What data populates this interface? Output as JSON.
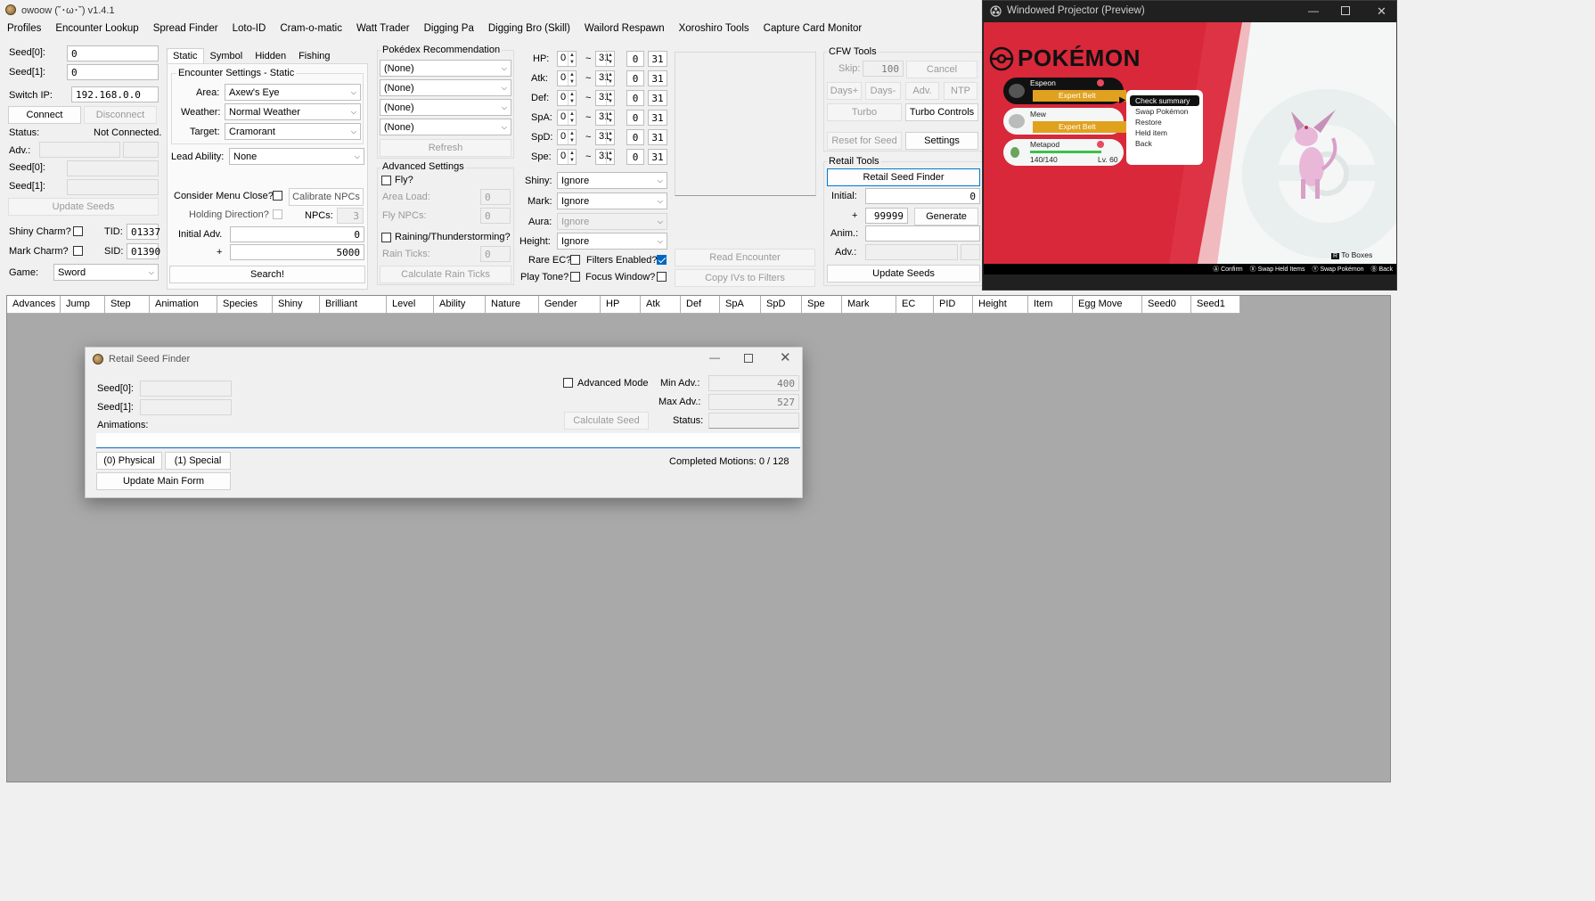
{
  "window": {
    "title": "owoow (˘･ω･˘) v1.4.1"
  },
  "menu": [
    "Profiles",
    "Encounter Lookup",
    "Spread Finder",
    "Loto-ID",
    "Cram-o-matic",
    "Watt Trader",
    "Digging Pa",
    "Digging Bro (Skill)",
    "Wailord Respawn",
    "Xoroshiro Tools",
    "Capture Card Monitor"
  ],
  "left": {
    "seed0_label": "Seed[0]:",
    "seed0": "0",
    "seed1_label": "Seed[1]:",
    "seed1": "0",
    "switch_ip_label": "Switch IP:",
    "switch_ip": "192.168.0.0",
    "connect": "Connect",
    "disconnect": "Disconnect",
    "status_label": "Status:",
    "status": "Not Connected.",
    "adv_label": "Adv.:",
    "seed0b_label": "Seed[0]:",
    "seed1b_label": "Seed[1]:",
    "update_seeds": "Update Seeds",
    "shiny_charm": "Shiny Charm?",
    "mark_charm": "Mark Charm?",
    "tid_label": "TID:",
    "tid": "01337",
    "sid_label": "SID:",
    "sid": "01390",
    "game_label": "Game:",
    "game": "Sword"
  },
  "encounter": {
    "tabs": [
      "Static",
      "Symbol",
      "Hidden",
      "Fishing"
    ],
    "group_title": "Encounter Settings - Static",
    "area_label": "Area:",
    "area": "Axew's Eye",
    "weather_label": "Weather:",
    "weather": "Normal Weather",
    "target_label": "Target:",
    "target": "Cramorant",
    "lead_label": "Lead Ability:",
    "lead": "None",
    "menu_close": "Consider Menu Close?",
    "calibrate": "Calibrate NPCs",
    "holding": "Holding Direction?",
    "npcs_label": "NPCs:",
    "npcs": "3",
    "initial_label": "Initial Adv.",
    "initial": "0",
    "plus": "+",
    "plus_val": "5000",
    "search": "Search!"
  },
  "pokedex": {
    "title": "Pokédex Recommendation",
    "options": [
      "(None)",
      "(None)",
      "(None)",
      "(None)"
    ],
    "refresh": "Refresh",
    "adv_title": "Advanced Settings",
    "fly": "Fly?",
    "area_load": "Area Load:",
    "area_load_val": "0",
    "fly_npcs": "Fly NPCs:",
    "fly_npcs_val": "0",
    "raining": "Raining/Thunderstorming?",
    "rain_ticks": "Rain Ticks:",
    "rain_ticks_val": "0",
    "calc_rain": "Calculate Rain Ticks"
  },
  "ivs": {
    "rows": [
      {
        "label": "HP:",
        "min": "0",
        "max": "31",
        "a": "0",
        "b": "31"
      },
      {
        "label": "Atk:",
        "min": "0",
        "max": "31",
        "a": "0",
        "b": "31"
      },
      {
        "label": "Def:",
        "min": "0",
        "max": "31",
        "a": "0",
        "b": "31"
      },
      {
        "label": "SpA:",
        "min": "0",
        "max": "31",
        "a": "0",
        "b": "31"
      },
      {
        "label": "SpD:",
        "min": "0",
        "max": "31",
        "a": "0",
        "b": "31"
      },
      {
        "label": "Spe:",
        "min": "0",
        "max": "31",
        "a": "0",
        "b": "31"
      }
    ],
    "tilde": "~",
    "shiny_label": "Shiny:",
    "shiny": "Ignore",
    "mark_label": "Mark:",
    "mark": "Ignore",
    "aura_label": "Aura:",
    "aura": "Ignore",
    "height_label": "Height:",
    "height": "Ignore",
    "rare_ec": "Rare EC?",
    "filters_enabled": "Filters Enabled?",
    "play_tone": "Play Tone?",
    "focus_window": "Focus Window?"
  },
  "readenc": {
    "read": "Read Encounter",
    "copy": "Copy IVs to Filters"
  },
  "cfw": {
    "title": "CFW Tools",
    "skip": "Skip:",
    "skip_val": "100",
    "cancel": "Cancel",
    "days_plus": "Days+",
    "days_minus": "Days-",
    "adv": "Adv.",
    "ntp": "NTP",
    "turbo": "Turbo",
    "turbo_controls": "Turbo Controls",
    "reset_seed": "Reset for Seed",
    "settings": "Settings"
  },
  "retail": {
    "title": "Retail Tools",
    "finder": "Retail Seed Finder",
    "initial_label": "Initial:",
    "initial": "0",
    "plus": "+",
    "plus_val": "99999",
    "generate": "Generate",
    "anim_label": "Anim.:",
    "adv_label": "Adv.:",
    "update_seeds": "Update Seeds"
  },
  "table": {
    "columns": [
      "Advances",
      "Jump",
      "Step",
      "Animation",
      "Species",
      "Shiny",
      "Brilliant",
      "Level",
      "Ability",
      "Nature",
      "Gender",
      "HP",
      "Atk",
      "Def",
      "SpA",
      "SpD",
      "Spe",
      "Mark",
      "EC",
      "PID",
      "Height",
      "Item",
      "Egg Move",
      "Seed0",
      "Seed1"
    ]
  },
  "dialog": {
    "title": "Retail Seed Finder",
    "seed0": "Seed[0]:",
    "seed1": "Seed[1]:",
    "animations": "Animations:",
    "advanced": "Advanced Mode",
    "min_adv_label": "Min Adv.:",
    "min_adv": "400",
    "max_adv_label": "Max Adv.:",
    "max_adv": "527",
    "calc_seed": "Calculate Seed",
    "status_label": "Status:",
    "physical": "(0) Physical",
    "special": "(1) Special",
    "completed": "Completed Motions: 0 / 128",
    "update_main": "Update Main Form"
  },
  "projector": {
    "title": "Windowed Projector (Preview)",
    "logo": "POKÉMON",
    "party": [
      {
        "name": "Espeon",
        "item": "Expert Belt"
      },
      {
        "name": "Mew",
        "item": "Expert Belt"
      },
      {
        "name": "Metapod",
        "hp": "140/140",
        "level": "Lv. 60"
      }
    ],
    "menu": [
      "Check summary",
      "Swap Pokémon",
      "Restore",
      "Held item",
      "Back"
    ],
    "to_boxes": "To Boxes",
    "controls": [
      "Confirm",
      "Swap Held Items",
      "Swap Pokémon",
      "Back"
    ],
    "accent": "#d8283a",
    "gold": "#e0a21e"
  }
}
